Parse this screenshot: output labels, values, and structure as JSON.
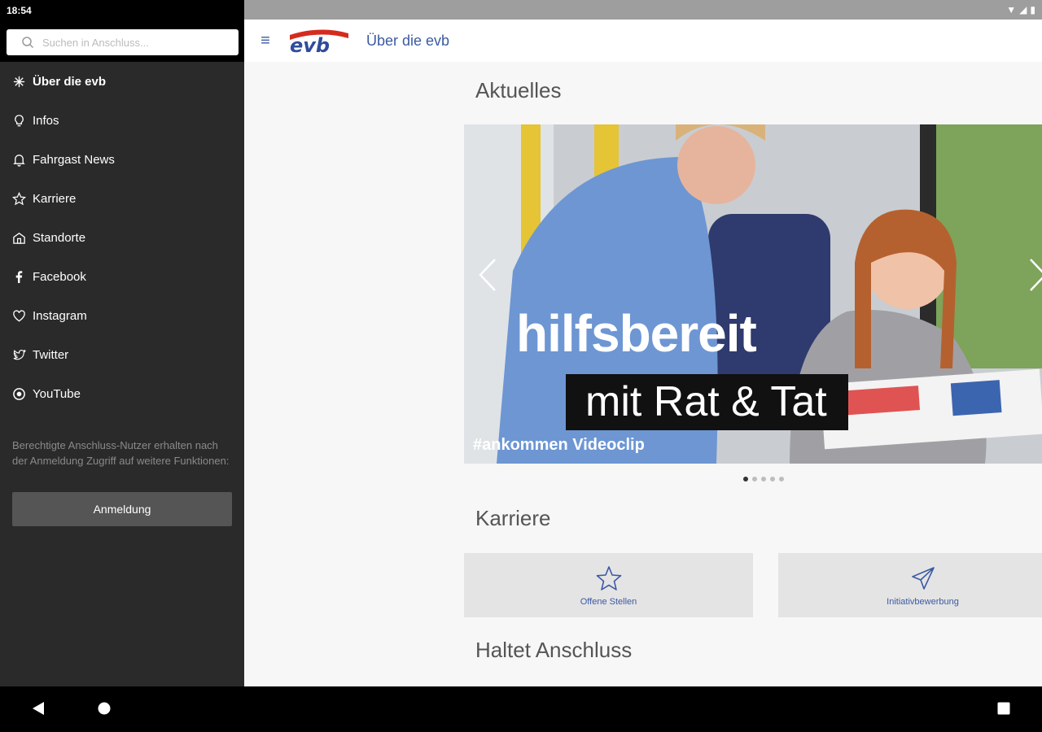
{
  "status_bar": {
    "time": "18:54"
  },
  "drawer": {
    "search": {
      "placeholder": "Suchen in Anschluss..."
    },
    "items": [
      {
        "label": "Über die evb",
        "icon": "sparkle-icon",
        "active": true
      },
      {
        "label": "Infos",
        "icon": "lightbulb-icon"
      },
      {
        "label": "Fahrgast News",
        "icon": "bell-icon"
      },
      {
        "label": "Karriere",
        "icon": "star-icon"
      },
      {
        "label": "Standorte",
        "icon": "building-icon"
      },
      {
        "label": "Facebook",
        "icon": "facebook-icon"
      },
      {
        "label": "Instagram",
        "icon": "heart-icon"
      },
      {
        "label": "Twitter",
        "icon": "twitter-icon"
      },
      {
        "label": "YouTube",
        "icon": "youtube-icon"
      }
    ],
    "note": "Berechtigte Anschluss-Nutzer erhalten nach der Anmeldung Zugriff auf weitere Funktionen:",
    "login_label": "Anmeldung"
  },
  "appbar": {
    "logo_text": "evb",
    "title": "Über die evb"
  },
  "main": {
    "news_title": "Aktuelles",
    "slide": {
      "headline": "hilfsbereit",
      "sub": "mit Rat & Tat",
      "caption": "#ankommen Videoclip"
    },
    "slide_count": 5,
    "active_slide": 1,
    "career_title": "Karriere",
    "tiles": [
      {
        "label": "Offene Stellen",
        "icon": "star-outline-icon"
      },
      {
        "label": "Initiativbewerbung",
        "icon": "paper-plane-icon"
      }
    ],
    "anschluss_title": "Haltet Anschluss"
  },
  "colors": {
    "accent": "#3b5aa3",
    "brand_red": "#d52b1e",
    "drawer_bg": "#2a2a2a"
  }
}
